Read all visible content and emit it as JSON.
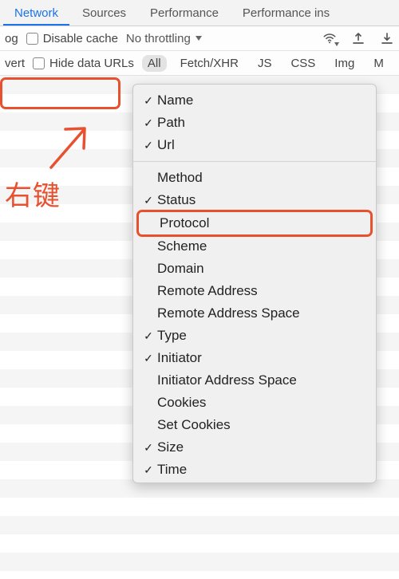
{
  "tabs": {
    "network": "Network",
    "sources": "Sources",
    "performance": "Performance",
    "perf_ins": "Performance ins"
  },
  "toolbar": {
    "log_frag": "og",
    "disable_cache": "Disable cache",
    "throttling": "No throttling"
  },
  "filter": {
    "vert_frag": "vert",
    "hide_data_urls": "Hide data URLs",
    "all": "All",
    "fetch": "Fetch/XHR",
    "js": "JS",
    "css": "CSS",
    "img": "Img",
    "m_frag": "M"
  },
  "annotation": {
    "text": "右键"
  },
  "context_menu": {
    "items": [
      {
        "label": "Name",
        "checked": true
      },
      {
        "label": "Path",
        "checked": true
      },
      {
        "label": "Url",
        "checked": true
      },
      {
        "sep": true
      },
      {
        "label": "Method",
        "checked": false
      },
      {
        "label": "Status",
        "checked": true
      },
      {
        "label": "Protocol",
        "checked": false,
        "highlight": true
      },
      {
        "label": "Scheme",
        "checked": false
      },
      {
        "label": "Domain",
        "checked": false
      },
      {
        "label": "Remote Address",
        "checked": false
      },
      {
        "label": "Remote Address Space",
        "checked": false
      },
      {
        "label": "Type",
        "checked": true
      },
      {
        "label": "Initiator",
        "checked": true
      },
      {
        "label": "Initiator Address Space",
        "checked": false
      },
      {
        "label": "Cookies",
        "checked": false
      },
      {
        "label": "Set Cookies",
        "checked": false
      },
      {
        "label": "Size",
        "checked": true
      },
      {
        "label": "Time",
        "checked": true
      }
    ]
  }
}
